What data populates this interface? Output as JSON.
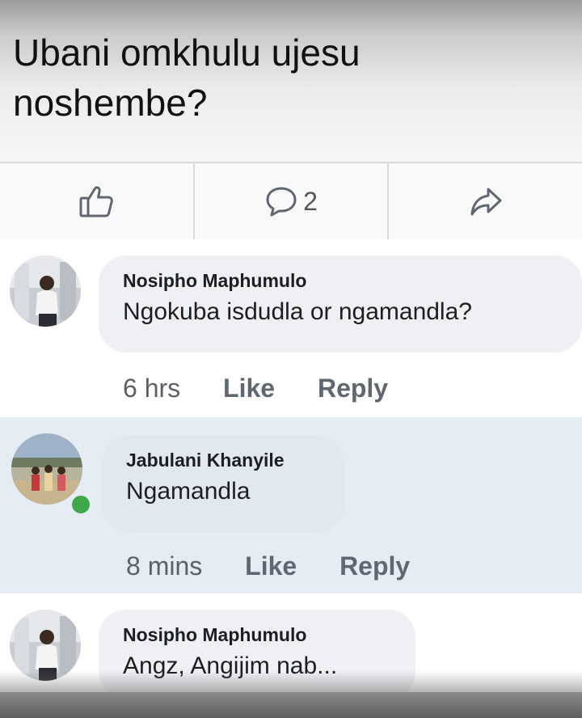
{
  "post": {
    "text": "Ubani omkhulu ujesu noshembe?"
  },
  "actions": {
    "like_icon": "thumbs-up-icon",
    "comment_icon": "comment-icon",
    "comment_count": "2",
    "share_icon": "share-icon"
  },
  "comments": [
    {
      "author": "Nosipho Maphumulo",
      "text": "Ngokuba isdudla or ngamandla?",
      "time": "6 hrs",
      "like_label": "Like",
      "reply_label": "Reply"
    },
    {
      "author": "Jabulani Khanyile",
      "text": "Ngamandla",
      "time": "8 mins",
      "like_label": "Like",
      "reply_label": "Reply",
      "online": true
    },
    {
      "author": "Nosipho Maphumulo",
      "text": "Angz, Angijim nab..."
    }
  ],
  "colors": {
    "online": "#3ea84a",
    "highlight_bg": "#e5ecf4",
    "bubble_bg": "#eef0f3"
  }
}
